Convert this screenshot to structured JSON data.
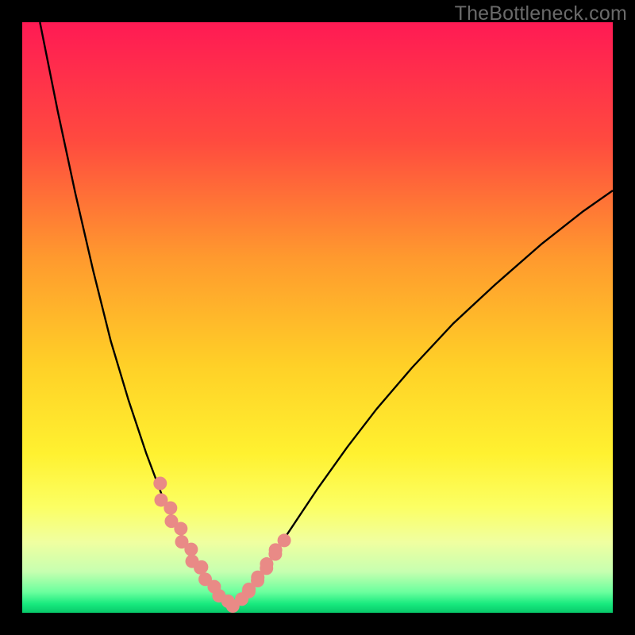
{
  "watermark": "TheBottleneck.com",
  "chart_data": {
    "type": "line",
    "title": "",
    "xlabel": "",
    "ylabel": "",
    "xlim": [
      0,
      100
    ],
    "ylim": [
      0,
      100
    ],
    "series": [
      {
        "name": "left-curve",
        "x": [
          3,
          6,
          9,
          12,
          15,
          18,
          21,
          24,
          25.5,
          27,
          28.5,
          30,
          31.5,
          33,
          34.5,
          35.5
        ],
        "y": [
          100,
          85,
          71,
          58,
          46,
          36,
          27,
          19,
          16,
          13,
          10,
          7.5,
          5.3,
          3.5,
          2,
          1
        ]
      },
      {
        "name": "right-curve",
        "x": [
          35.5,
          37,
          39,
          41,
          43,
          46,
          50,
          55,
          60,
          66,
          73,
          80,
          88,
          95,
          100
        ],
        "y": [
          1,
          2.2,
          4.5,
          7.3,
          10.5,
          15,
          21,
          28,
          34.5,
          41.5,
          49,
          55.5,
          62.5,
          68,
          71.5
        ]
      }
    ],
    "marker_clusters": [
      {
        "name": "left-cluster",
        "x_range": [
          23,
          30
        ],
        "y_range": [
          8,
          22
        ],
        "count_approx": 9
      },
      {
        "name": "right-cluster",
        "x_range": [
          38,
          44
        ],
        "y_range": [
          6,
          20
        ],
        "count_approx": 9
      },
      {
        "name": "trough",
        "x_range": [
          30,
          37
        ],
        "y_range": [
          1,
          5
        ],
        "count_approx": 7
      }
    ],
    "gradient_stops": [
      {
        "offset": 0.0,
        "color": "#ff1a54"
      },
      {
        "offset": 0.2,
        "color": "#ff4a3f"
      },
      {
        "offset": 0.4,
        "color": "#ff9a2e"
      },
      {
        "offset": 0.58,
        "color": "#ffd027"
      },
      {
        "offset": 0.73,
        "color": "#fff130"
      },
      {
        "offset": 0.82,
        "color": "#fcff63"
      },
      {
        "offset": 0.88,
        "color": "#f0ffa0"
      },
      {
        "offset": 0.93,
        "color": "#c7ffb0"
      },
      {
        "offset": 0.965,
        "color": "#6bff9e"
      },
      {
        "offset": 0.985,
        "color": "#18ea7e"
      },
      {
        "offset": 1.0,
        "color": "#08c96a"
      }
    ],
    "marker_color": "#e98a86",
    "curve_color": "#000000"
  }
}
